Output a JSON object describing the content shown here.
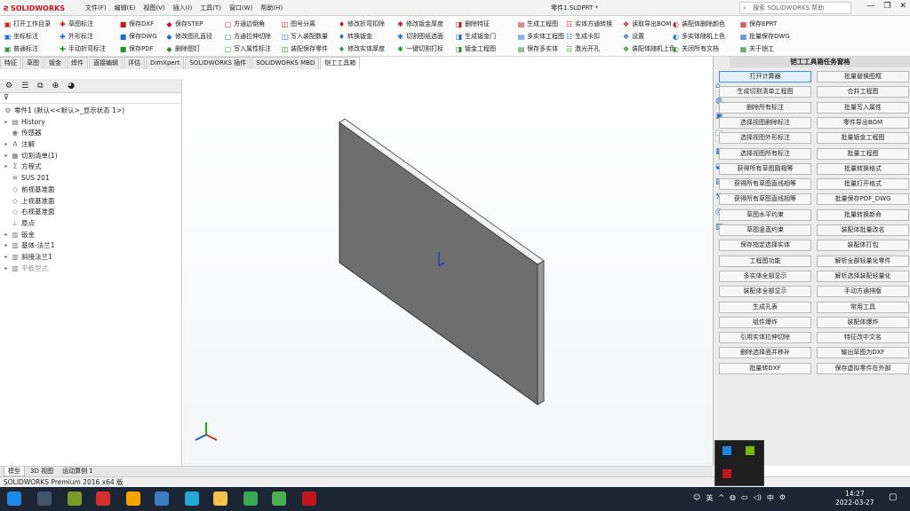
{
  "app": {
    "logo": "SOLIDWORKS",
    "doc_title": "零件1.SLDPRT *",
    "search_placeholder": "搜索 SOLIDWORKS 帮助"
  },
  "menu": [
    "文件(F)",
    "编辑(E)",
    "视图(V)",
    "插入(I)",
    "工具(T)",
    "窗口(W)",
    "帮助(H)"
  ],
  "ribbon": {
    "col1": [
      "打开工作目录",
      "坐标标注",
      "普通标注"
    ],
    "col2": [
      "草图标注",
      "外形标注",
      "手动折弯标注"
    ],
    "col3": [
      "保存DXF",
      "保存DWG",
      "保存PDF"
    ],
    "col4": [
      "保存STEP",
      "修改图孔直径",
      "删除图钉"
    ],
    "col5": [
      "方通边倒角",
      "方通拉伸切除",
      "写入属性标注"
    ],
    "col6": [
      "图号分离",
      "写入装配数量",
      "装配保存零件"
    ],
    "col7": [
      "修改折弯扣除",
      "转换钣金",
      "修改实体厚度"
    ],
    "col8": [
      "修改钣金厚度",
      "切割图纸选面",
      "一键切割打标"
    ],
    "col9": [
      "删除特征",
      "生成钣金门",
      "钣金工程图"
    ],
    "col10": [
      "生成工程图",
      "多实体工程图",
      "保存多实体"
    ],
    "col11": [
      "实体方通转换",
      "生成卡扣",
      "激光开孔"
    ],
    "col12": [
      "读取导出BOM",
      "设置",
      "装配体随机上色"
    ],
    "col13": [
      "装配体删除颜色",
      "多实体随机上色",
      "关闭所有文档"
    ],
    "col14": [
      "保存EPRT",
      "批量保存DWG",
      "关于铠工"
    ]
  },
  "tabs": [
    "特征",
    "草图",
    "钣金",
    "焊件",
    "直接编辑",
    "评估",
    "DimXpert",
    "SOLIDWORKS 插件",
    "SOLIDWORKS MBD",
    "铠工工具箱"
  ],
  "tree": [
    {
      "label": "零件1 (默认<<默认>_显示状态 1>)",
      "indent": 0,
      "toggle": "",
      "icon": "⚙",
      "dim": false
    },
    {
      "label": "History",
      "indent": 1,
      "toggle": "▸",
      "icon": "▤",
      "dim": false
    },
    {
      "label": "传感器",
      "indent": 1,
      "toggle": "",
      "icon": "◉",
      "dim": false
    },
    {
      "label": "注解",
      "indent": 1,
      "toggle": "▸",
      "icon": "A",
      "dim": false
    },
    {
      "label": "切割清单(1)",
      "indent": 1,
      "toggle": "▸",
      "icon": "▦",
      "dim": false
    },
    {
      "label": "方程式",
      "indent": 1,
      "toggle": "▸",
      "icon": "Σ",
      "dim": false
    },
    {
      "label": "SUS 201",
      "indent": 1,
      "toggle": "",
      "icon": "≋",
      "dim": false
    },
    {
      "label": "前视基准面",
      "indent": 1,
      "toggle": "",
      "icon": "◇",
      "dim": false
    },
    {
      "label": "上视基准面",
      "indent": 1,
      "toggle": "",
      "icon": "◇",
      "dim": false
    },
    {
      "label": "右视基准面",
      "indent": 1,
      "toggle": "",
      "icon": "◇",
      "dim": false
    },
    {
      "label": "原点",
      "indent": 1,
      "toggle": "",
      "icon": "⊥",
      "dim": false
    },
    {
      "label": "钣金",
      "indent": 1,
      "toggle": "▸",
      "icon": "▥",
      "dim": false
    },
    {
      "label": "基体-法兰1",
      "indent": 1,
      "toggle": "▸",
      "icon": "▥",
      "dim": false
    },
    {
      "label": "斜接法兰1",
      "indent": 1,
      "toggle": "▸",
      "icon": "▥",
      "dim": false
    },
    {
      "label": "平板型式",
      "indent": 1,
      "toggle": "▸",
      "icon": "▥",
      "dim": true
    }
  ],
  "taskpane": {
    "title": "铠工工具箱任务窗格",
    "left": [
      "打开计算器",
      "生成切割清单工程图",
      "删除所有标注",
      "选择视图删除标注",
      "选择视图外形标注",
      "选择视图所有标注",
      "获得所有草图圆相等",
      "获得所有草图直线相等",
      "获得所有草图直线相等",
      "草图水平约束",
      "草图竖直约束",
      "保存指定选择实体",
      "工程图功能",
      "多实体全部显示",
      "装配体全部显示",
      "生成孔表",
      "组件爆炸",
      "引用实体拉伸切除",
      "删除选择面并移补",
      "批量转DXF"
    ],
    "right": [
      "批量替换图框",
      "合并工程图",
      "批量写入属性",
      "零件导出BOM",
      "批量钣金工程图",
      "批量工程图",
      "批量转换格式",
      "批量打开格式",
      "批量保存PDF_DWG",
      "批量转换新命",
      "装配体批量改名",
      "装配体打包",
      "解析全部轻量化零件",
      "解析选择装配轻量化",
      "手动方通排版",
      "常用工具",
      "装配体爆炸",
      "特征改中文名",
      "输出草图为DXF",
      "保存虚拟零件在外部"
    ]
  },
  "bottom_tabs": [
    "模型",
    "3D 视图",
    "运动算例 1"
  ],
  "status": "SOLIDWORKS Premium 2016 x64 版",
  "clock": {
    "time": "14:27",
    "date": "2022-03-27"
  },
  "colors": {
    "accent": "#c4161c",
    "taskbar": "#1c2533",
    "highlight": "#3d8ee6"
  }
}
